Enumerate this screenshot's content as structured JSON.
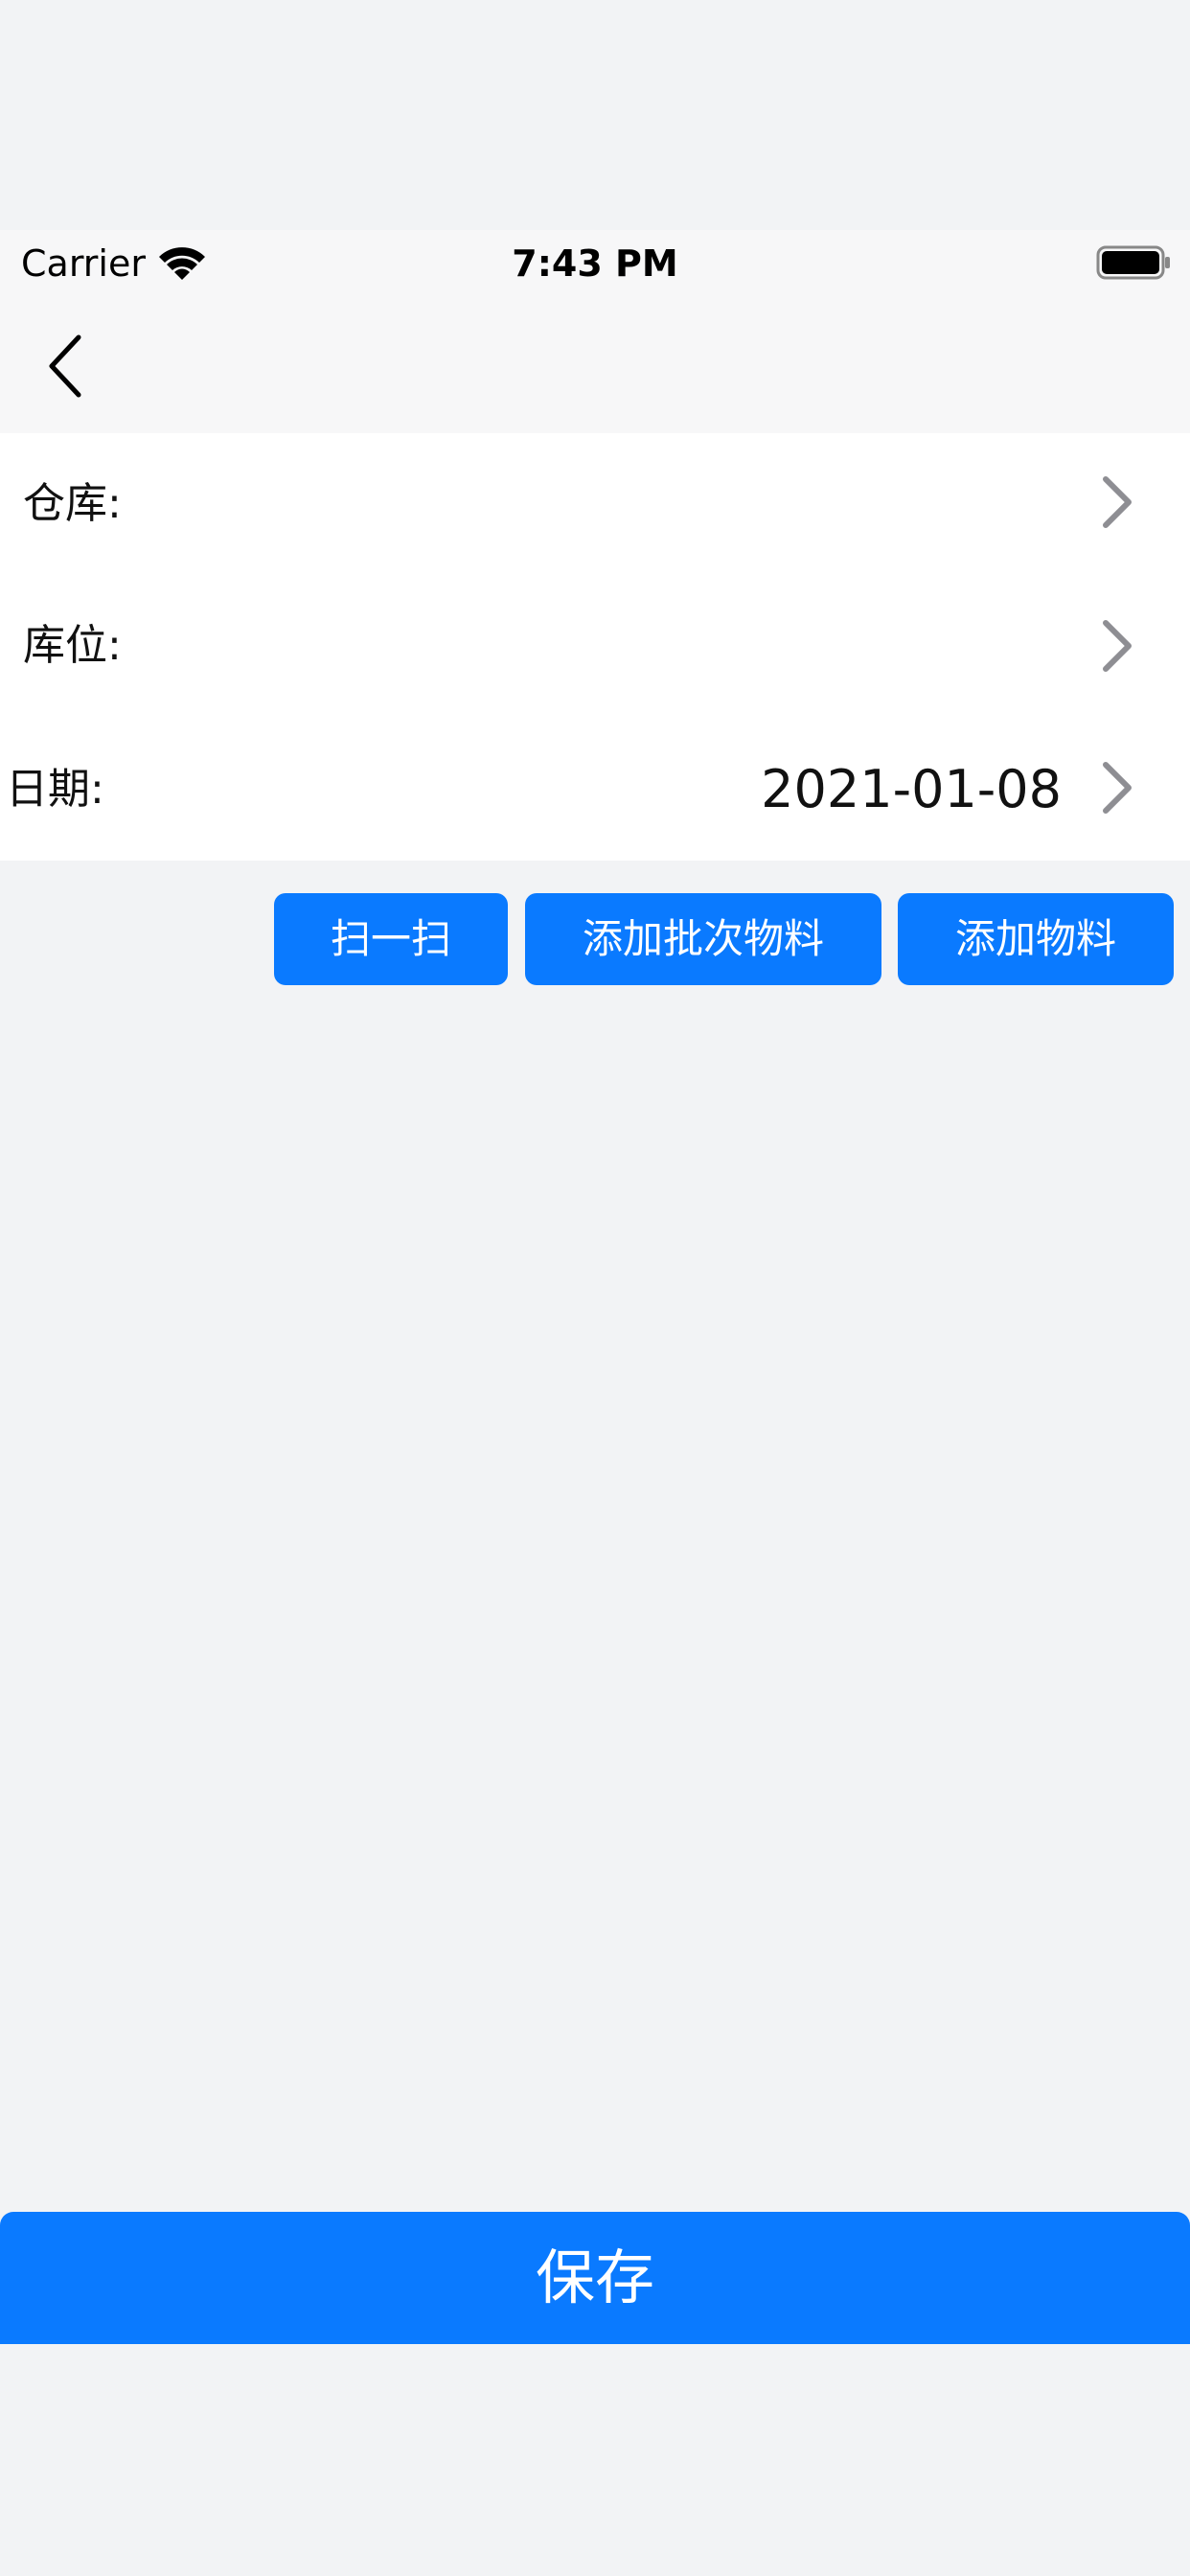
{
  "status_bar": {
    "carrier": "Carrier",
    "time": "7:43 PM"
  },
  "nav": {
    "back_icon": "chevron-left-icon"
  },
  "form": {
    "rows": [
      {
        "label": "仓库:",
        "value": ""
      },
      {
        "label": "库位:",
        "value": ""
      },
      {
        "label": "日期:",
        "value": "2021-01-08"
      }
    ]
  },
  "actions": {
    "scan": "扫一扫",
    "add_batch_material": "添加批次物料",
    "add_material": "添加物料"
  },
  "footer": {
    "save": "保存"
  },
  "colors": {
    "accent": "#0a7aff",
    "background": "#f2f3f5",
    "chevron": "#8e8e93"
  }
}
